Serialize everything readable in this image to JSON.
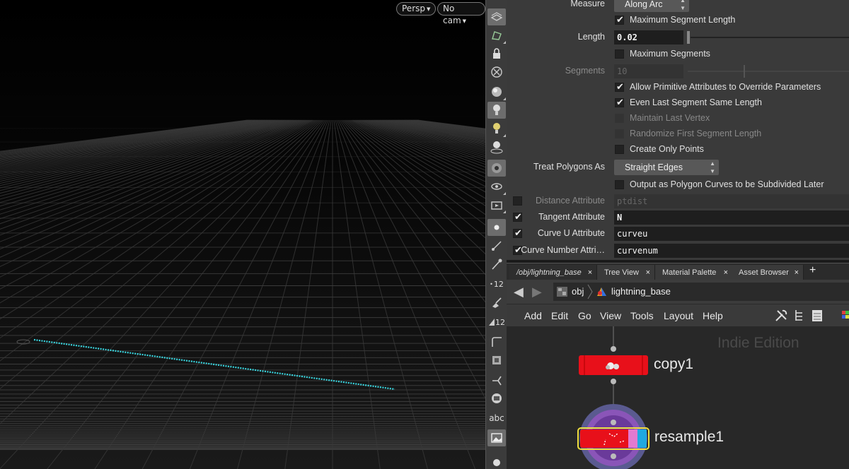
{
  "viewport": {
    "camera_menu": "Persp",
    "cam_select": "No cam"
  },
  "toolbar": {
    "icons": [
      "display-options-icon",
      "ghost-icon",
      "lock-icon",
      "xray-icon",
      "shading-icon",
      "light-icon",
      "headlight-icon",
      "ambient-light-icon",
      "camera-icon",
      "view-icon",
      "snapshot-icon",
      "point-icon",
      "normal-icon",
      "pin-icon",
      "point-number-icon",
      "brush-icon",
      "prim-number-icon",
      "corner-icon",
      "box-icon",
      "vector-icon",
      "rect-icon",
      "text-icon",
      "image-icon",
      "bulb-icon"
    ],
    "badge_12a": "12",
    "badge_12b": "12",
    "abc": "abc"
  },
  "params": {
    "measure_label": "Measure",
    "measure_value": "Along Arc",
    "max_seg_length_label": "Maximum Segment Length",
    "length_label": "Length",
    "length_value": "0.02",
    "max_segments_label": "Maximum Segments",
    "segments_label": "Segments",
    "segments_value": "10",
    "allow_prim_label": "Allow Primitive Attributes to Override Parameters",
    "even_last_label": "Even Last Segment Same Length",
    "maintain_last_label": "Maintain Last Vertex",
    "randomize_label": "Randomize First Segment Length",
    "create_only_label": "Create Only Points",
    "treat_label": "Treat Polygons As",
    "treat_value": "Straight Edges",
    "output_label": "Output as Polygon Curves to be Subdivided Later",
    "distance_label": "Distance Attribute",
    "distance_value": "ptdist",
    "tangent_label": "Tangent Attribute",
    "tangent_value": "N",
    "curveu_label": "Curve U Attribute",
    "curveu_value": "curveu",
    "curvenum_label": "Curve Number Attri…",
    "curvenum_value": "curvenum"
  },
  "tabs": [
    {
      "label": "/obj/lightning_base"
    },
    {
      "label": "Tree View"
    },
    {
      "label": "Material Palette"
    },
    {
      "label": "Asset Browser"
    }
  ],
  "tab_close": "×",
  "tab_add": "+",
  "path": {
    "root": "obj",
    "node": "lightning_base"
  },
  "menu": [
    "Add",
    "Edit",
    "Go",
    "View",
    "Tools",
    "Layout",
    "Help"
  ],
  "network": {
    "watermark": "Indie Edition",
    "node1": "copy1",
    "node2": "resample1"
  },
  "colors": {
    "node_red": "#e8101a",
    "curve_cyan": "#39d6e0",
    "selected_yellow": "#f0e040"
  }
}
